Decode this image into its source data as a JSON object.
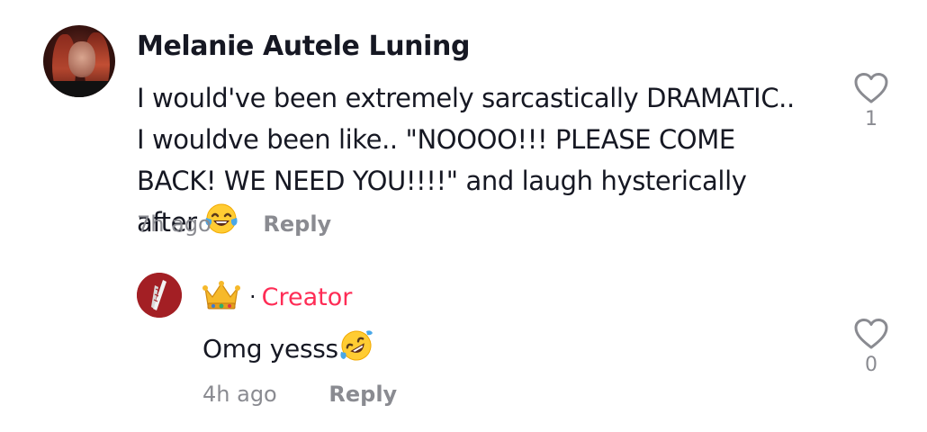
{
  "comment": {
    "author": "Melanie Autele Luning",
    "text_before_emoji": "I would've been extremely sarcastically DRAMATIC.. I wouldve been like.. \"NOOOO!!! PLEASE COME BACK! WE NEED YOU!!!!\" and laugh hysterically after",
    "emoji": "face-with-tears-of-joy",
    "time": "7h ago",
    "reply_label": "Reply",
    "like_count": "1",
    "like_icon": "heart-outline-icon"
  },
  "reply": {
    "author_emoji": "crown",
    "separator": "·",
    "badge": "Creator",
    "text": "Omg yesss",
    "emoji": "rolling-on-the-floor-laughing",
    "time": "4h ago",
    "reply_label": "Reply",
    "like_count": "0",
    "like_icon": "heart-outline-icon"
  },
  "colors": {
    "text": "#161823",
    "muted": "#8a8b91",
    "creator": "#fe2c55",
    "reply_avatar_bg": "#a31f24"
  }
}
